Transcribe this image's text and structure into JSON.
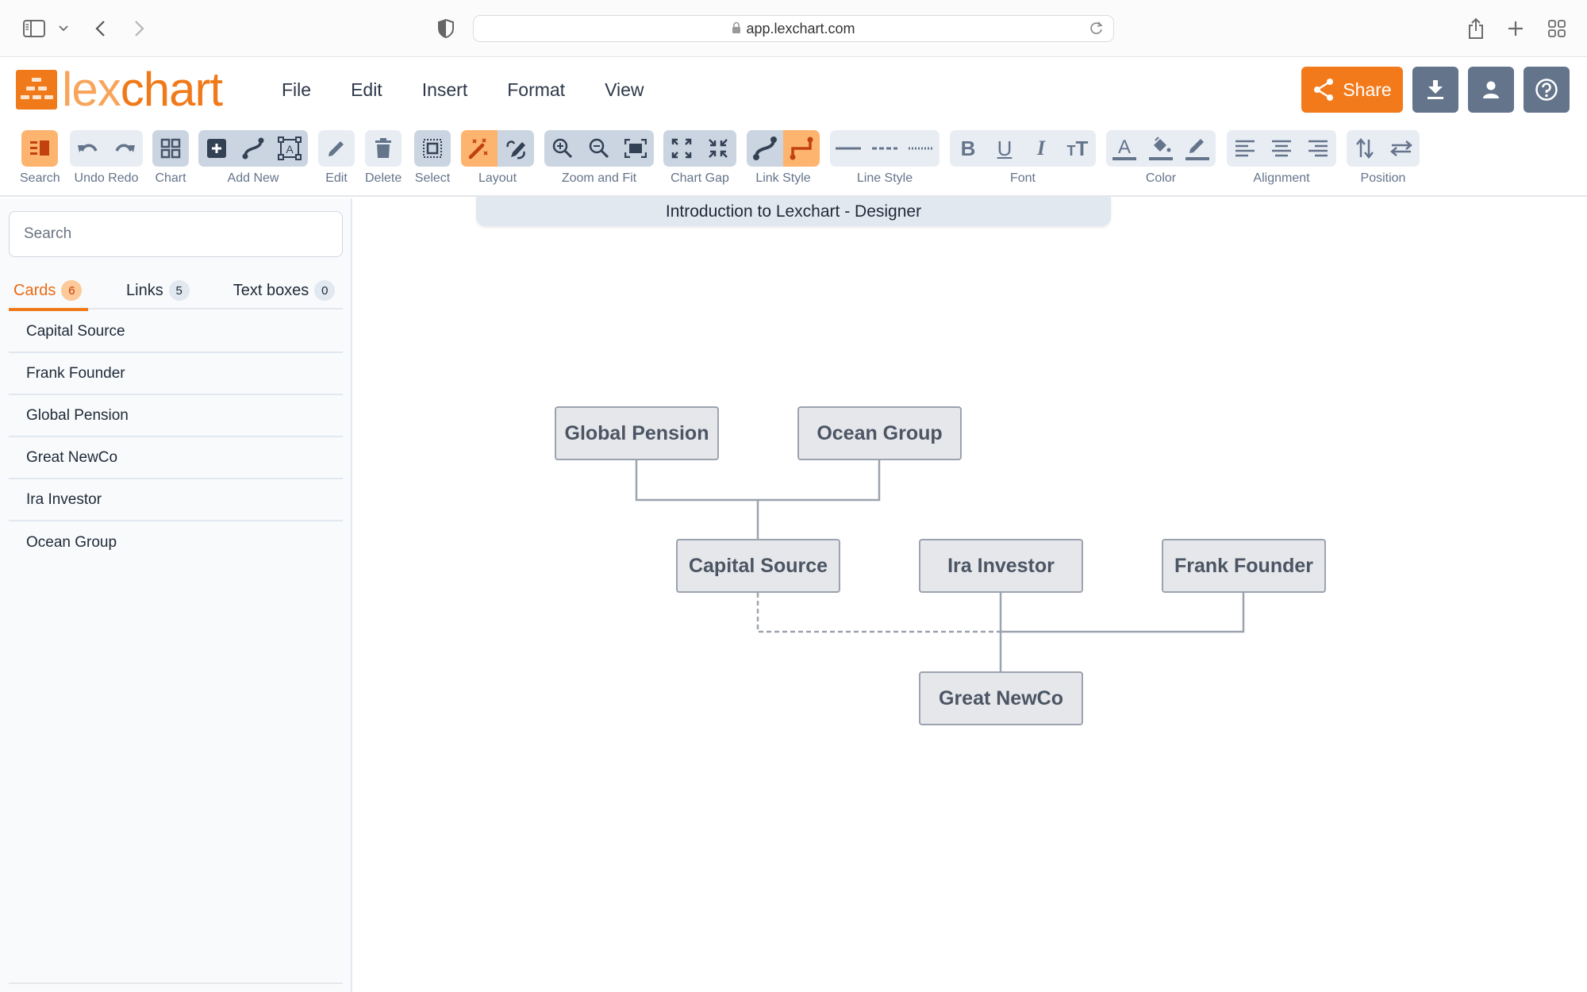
{
  "browser": {
    "url": "app.lexchart.com",
    "icons": [
      "sidebar-toggle-icon",
      "chevron-down-icon",
      "back-icon",
      "forward-icon",
      "privacy-shield-icon",
      "lock-icon",
      "reload-icon",
      "share-icon",
      "new-tab-icon",
      "tab-overview-icon"
    ]
  },
  "app": {
    "logo": {
      "part1": "lex",
      "part2": "chart"
    },
    "menu": [
      "File",
      "Edit",
      "Insert",
      "Format",
      "View"
    ],
    "share_label": "Share",
    "accent": "#f07a1a"
  },
  "toolbar": {
    "groups": [
      {
        "label": "Search",
        "buttons": [
          "search-panel"
        ]
      },
      {
        "label": "Undo Redo",
        "buttons": [
          "undo",
          "redo"
        ]
      },
      {
        "label": "Chart",
        "buttons": [
          "chart-grid"
        ]
      },
      {
        "label": "Add New",
        "buttons": [
          "add-card",
          "add-link",
          "add-text-box"
        ]
      },
      {
        "label": "Edit",
        "buttons": [
          "edit"
        ]
      },
      {
        "label": "Delete",
        "buttons": [
          "delete"
        ]
      },
      {
        "label": "Select",
        "buttons": [
          "select"
        ]
      },
      {
        "label": "Layout",
        "buttons": [
          "auto-layout",
          "manual-layout"
        ]
      },
      {
        "label": "Zoom and Fit",
        "buttons": [
          "zoom-in",
          "zoom-out",
          "fit"
        ]
      },
      {
        "label": "Chart Gap",
        "buttons": [
          "expand-gap",
          "shrink-gap"
        ]
      },
      {
        "label": "Link Style",
        "buttons": [
          "curved-link",
          "elbow-link"
        ]
      },
      {
        "label": "Line Style",
        "buttons": [
          "solid-line",
          "dashed-line",
          "dotted-line"
        ]
      },
      {
        "label": "Font",
        "buttons": [
          "bold",
          "underline",
          "italic",
          "text-size"
        ]
      },
      {
        "label": "Color",
        "buttons": [
          "font-color",
          "fill-color",
          "line-color"
        ]
      },
      {
        "label": "Alignment",
        "buttons": [
          "align-left",
          "align-center",
          "align-right"
        ]
      },
      {
        "label": "Position",
        "buttons": [
          "swap-vertical",
          "swap-horizontal"
        ]
      }
    ]
  },
  "sidebar": {
    "search_placeholder": "Search",
    "tabs": [
      {
        "label": "Cards",
        "count": "6",
        "active": true
      },
      {
        "label": "Links",
        "count": "5",
        "active": false
      },
      {
        "label": "Text boxes",
        "count": "0",
        "active": false
      }
    ],
    "cards": [
      "Capital Source",
      "Frank Founder",
      "Global Pension",
      "Great NewCo",
      "Ira Investor",
      "Ocean Group"
    ]
  },
  "canvas": {
    "title": "Introduction to Lexchart - Designer",
    "cards": [
      {
        "id": "global-pension",
        "label": "Global Pension"
      },
      {
        "id": "ocean-group",
        "label": "Ocean Group"
      },
      {
        "id": "capital-source",
        "label": "Capital Source"
      },
      {
        "id": "ira-investor",
        "label": "Ira Investor"
      },
      {
        "id": "frank-founder",
        "label": "Frank Founder"
      },
      {
        "id": "great-newco",
        "label": "Great NewCo"
      }
    ],
    "links": [
      {
        "from": "global-pension",
        "to": "capital-source",
        "style": "solid"
      },
      {
        "from": "ocean-group",
        "to": "capital-source",
        "style": "solid"
      },
      {
        "from": "capital-source",
        "to": "great-newco",
        "style": "dashed"
      },
      {
        "from": "ira-investor",
        "to": "great-newco",
        "style": "solid"
      },
      {
        "from": "frank-founder",
        "to": "great-newco",
        "style": "solid"
      }
    ]
  }
}
